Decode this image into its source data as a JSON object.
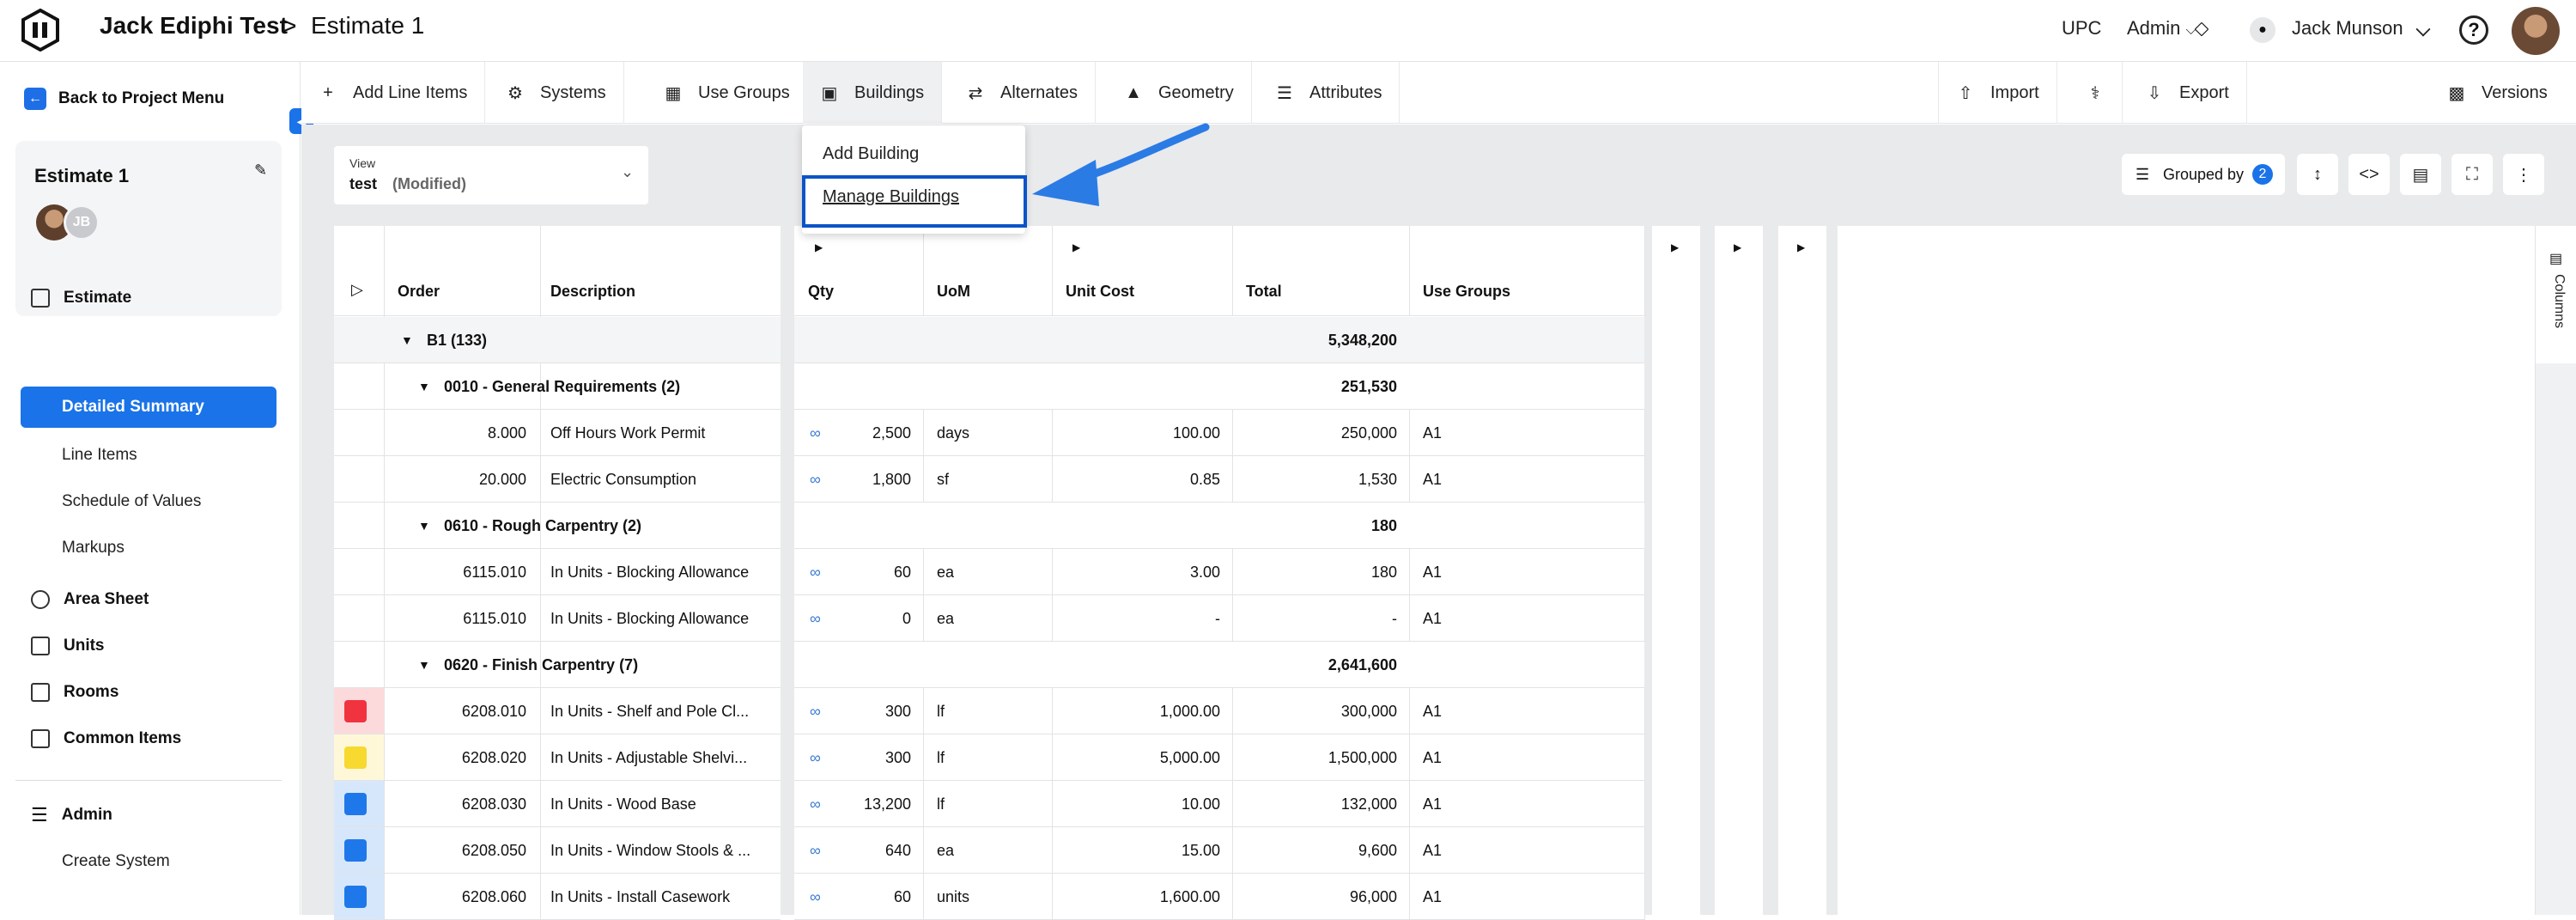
{
  "header": {
    "project": "Jack Ediphi Test",
    "separator": ">",
    "estimate": "Estimate 1",
    "company": "UPC",
    "role": "Admin",
    "user": "Jack Munson"
  },
  "sidebar": {
    "back": "Back to Project Menu",
    "estimate_card": {
      "title": "Estimate 1",
      "avatar2_initials": "JB"
    },
    "items": [
      {
        "label": "Estimate"
      },
      {
        "label": "Detailed Summary"
      },
      {
        "label": "Line Items"
      },
      {
        "label": "Schedule of Values"
      },
      {
        "label": "Markups"
      },
      {
        "label": "Area Sheet"
      },
      {
        "label": "Units"
      },
      {
        "label": "Rooms"
      },
      {
        "label": "Common Items"
      },
      {
        "label": "Admin"
      },
      {
        "label": "Create System"
      }
    ]
  },
  "toolbar": {
    "add_line_items": "Add Line Items",
    "systems": "Systems",
    "use_groups": "Use Groups",
    "buildings": "Buildings",
    "alternates": "Alternates",
    "geometry": "Geometry",
    "attributes": "Attributes",
    "import": "Import",
    "export": "Export",
    "versions": "Versions"
  },
  "buildings_menu": {
    "add": "Add Building",
    "manage": "Manage Buildings"
  },
  "view": {
    "label": "View",
    "name": "test",
    "status": "(Modified)"
  },
  "grouped_by": {
    "label": "Grouped by",
    "count": "2"
  },
  "columns_label": "Columns",
  "table": {
    "headers": {
      "order": "Order",
      "description": "Description",
      "qty": "Qty",
      "uom": "UoM",
      "unit_cost": "Unit Cost",
      "total": "Total",
      "use_groups": "Use Groups"
    },
    "rows": [
      {
        "kind": "group1",
        "label": "B1 (133)",
        "total": "5,348,200"
      },
      {
        "kind": "group2",
        "label": "0010 - General Requirements (2)",
        "total": "251,530"
      },
      {
        "kind": "item",
        "order": "8.000",
        "desc": "Off Hours Work Permit",
        "qty": "2,500",
        "uom": "days",
        "unit_cost": "100.00",
        "total": "250,000",
        "ug": "A1",
        "color": ""
      },
      {
        "kind": "item",
        "order": "20.000",
        "desc": "Electric Consumption",
        "qty": "1,800",
        "uom": "sf",
        "unit_cost": "0.85",
        "total": "1,530",
        "ug": "A1",
        "color": ""
      },
      {
        "kind": "group2",
        "label": "0610 - Rough Carpentry (2)",
        "total": "180"
      },
      {
        "kind": "item",
        "order": "6115.010",
        "desc": "In Units - Blocking Allowance",
        "qty": "60",
        "uom": "ea",
        "unit_cost": "3.00",
        "total": "180",
        "ug": "A1",
        "color": ""
      },
      {
        "kind": "item",
        "order": "6115.010",
        "desc": "In Units - Blocking Allowance",
        "qty": "0",
        "uom": "ea",
        "unit_cost": "-",
        "total": "-",
        "ug": "A1",
        "color": ""
      },
      {
        "kind": "group2",
        "label": "0620 - Finish Carpentry (7)",
        "total": "2,641,600"
      },
      {
        "kind": "item",
        "order": "6208.010",
        "desc": "In Units - Shelf and Pole Cl...",
        "qty": "300",
        "uom": "lf",
        "unit_cost": "1,000.00",
        "total": "300,000",
        "ug": "A1",
        "color": "#f0333f"
      },
      {
        "kind": "item",
        "order": "6208.020",
        "desc": "In Units - Adjustable Shelvi...",
        "qty": "300",
        "uom": "lf",
        "unit_cost": "5,000.00",
        "total": "1,500,000",
        "ug": "A1",
        "color": "#f7d92f"
      },
      {
        "kind": "item",
        "order": "6208.030",
        "desc": "In Units - Wood Base",
        "qty": "13,200",
        "uom": "lf",
        "unit_cost": "10.00",
        "total": "132,000",
        "ug": "A1",
        "color": "#1f78ea"
      },
      {
        "kind": "item",
        "order": "6208.050",
        "desc": "In Units - Window Stools & ...",
        "qty": "640",
        "uom": "ea",
        "unit_cost": "15.00",
        "total": "9,600",
        "ug": "A1",
        "color": "#1f78ea"
      },
      {
        "kind": "item",
        "order": "6208.060",
        "desc": "In Units - Install Casework",
        "qty": "60",
        "uom": "units",
        "unit_cost": "1,600.00",
        "total": "96,000",
        "ug": "A1",
        "color": "#1f78ea"
      }
    ]
  },
  "colors": {
    "accent": "#1a73e8",
    "highlight_border": "#0b54c8",
    "arrow": "#2b7be5",
    "link": "#3a7bd5"
  }
}
